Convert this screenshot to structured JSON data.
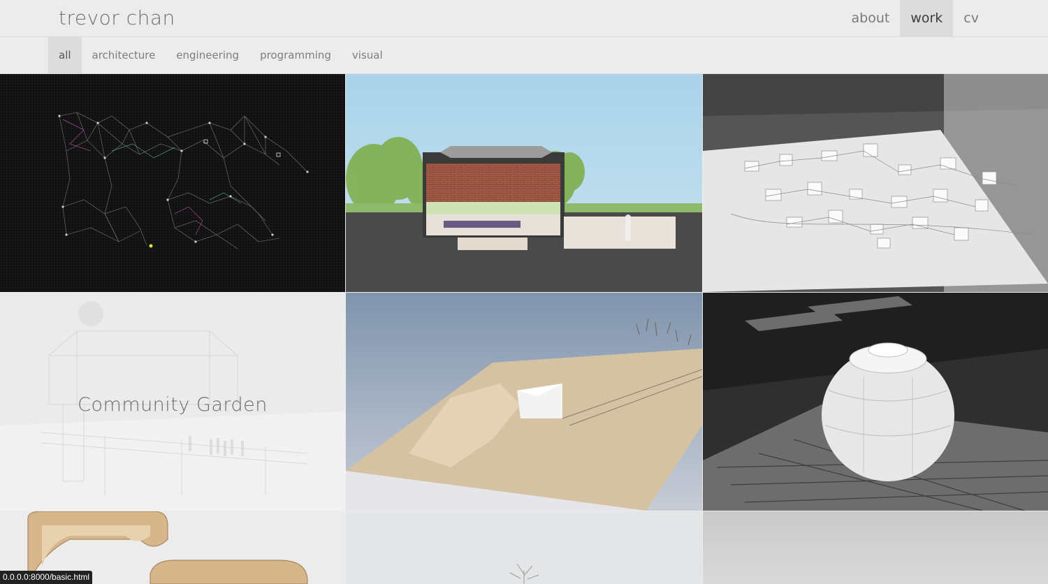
{
  "header": {
    "brand": "trevor chan",
    "nav": [
      {
        "label": "about",
        "active": false
      },
      {
        "label": "work",
        "active": true
      },
      {
        "label": "cv",
        "active": false
      }
    ]
  },
  "filters": {
    "items": [
      {
        "label": "all",
        "active": true
      },
      {
        "label": "architecture",
        "active": false
      },
      {
        "label": "engineering",
        "active": false
      },
      {
        "label": "programming",
        "active": false
      },
      {
        "label": "visual",
        "active": false
      }
    ]
  },
  "grid": {
    "hovered_title": "Community Garden"
  },
  "status": {
    "url": "0.0.0.0:8000/basic.html"
  }
}
